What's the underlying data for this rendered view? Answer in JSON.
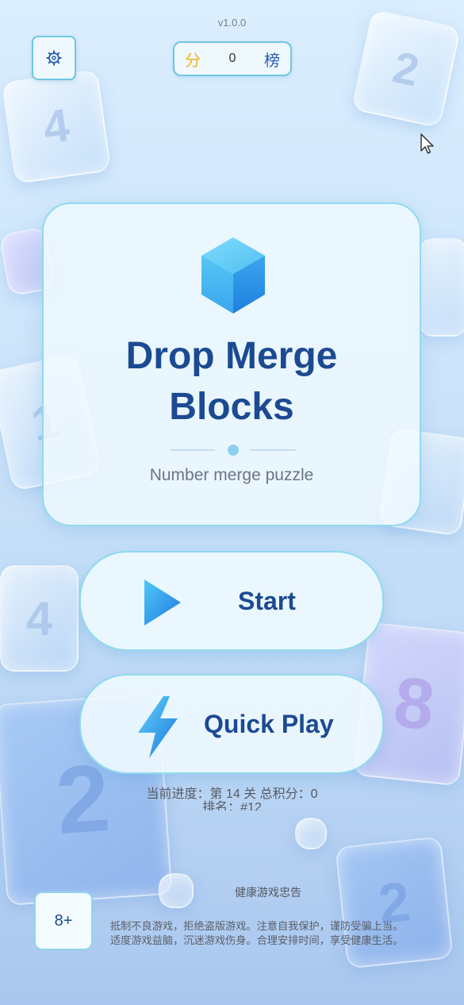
{
  "app": {
    "version": "v1.0.0"
  },
  "header": {
    "settings_icon": "gear-icon",
    "score_label": "分",
    "score_value": "0",
    "leaderboard_label": "榜"
  },
  "title_card": {
    "logo_icon": "cube-logo-icon",
    "title": "Drop Merge Blocks",
    "subtitle": "Number merge puzzle"
  },
  "buttons": {
    "start_label": "Start",
    "start_icon": "play-icon",
    "quick_play_label": "Quick Play",
    "quick_play_icon": "lightning-icon"
  },
  "progress": {
    "line1": "当前进度：第 14 关  总积分：0",
    "line2": "排名：#12"
  },
  "footer": {
    "age_rating": "8+",
    "notice_title": "健康游戏忠告",
    "notice_line1": "抵制不良游戏，拒绝盗版游戏。注意自我保护，谨防受骗上当。",
    "notice_line2": "适度游戏益脑，沉迷游戏伤身。合理安排时间，享受健康生活。"
  },
  "colors": {
    "accent_border": "#8fdaf0",
    "title_text": "#1c4a92",
    "score_label": "#f2b21f",
    "icon_gradient_start": "#5fd0f7",
    "icon_gradient_end": "#1f7fe0"
  }
}
